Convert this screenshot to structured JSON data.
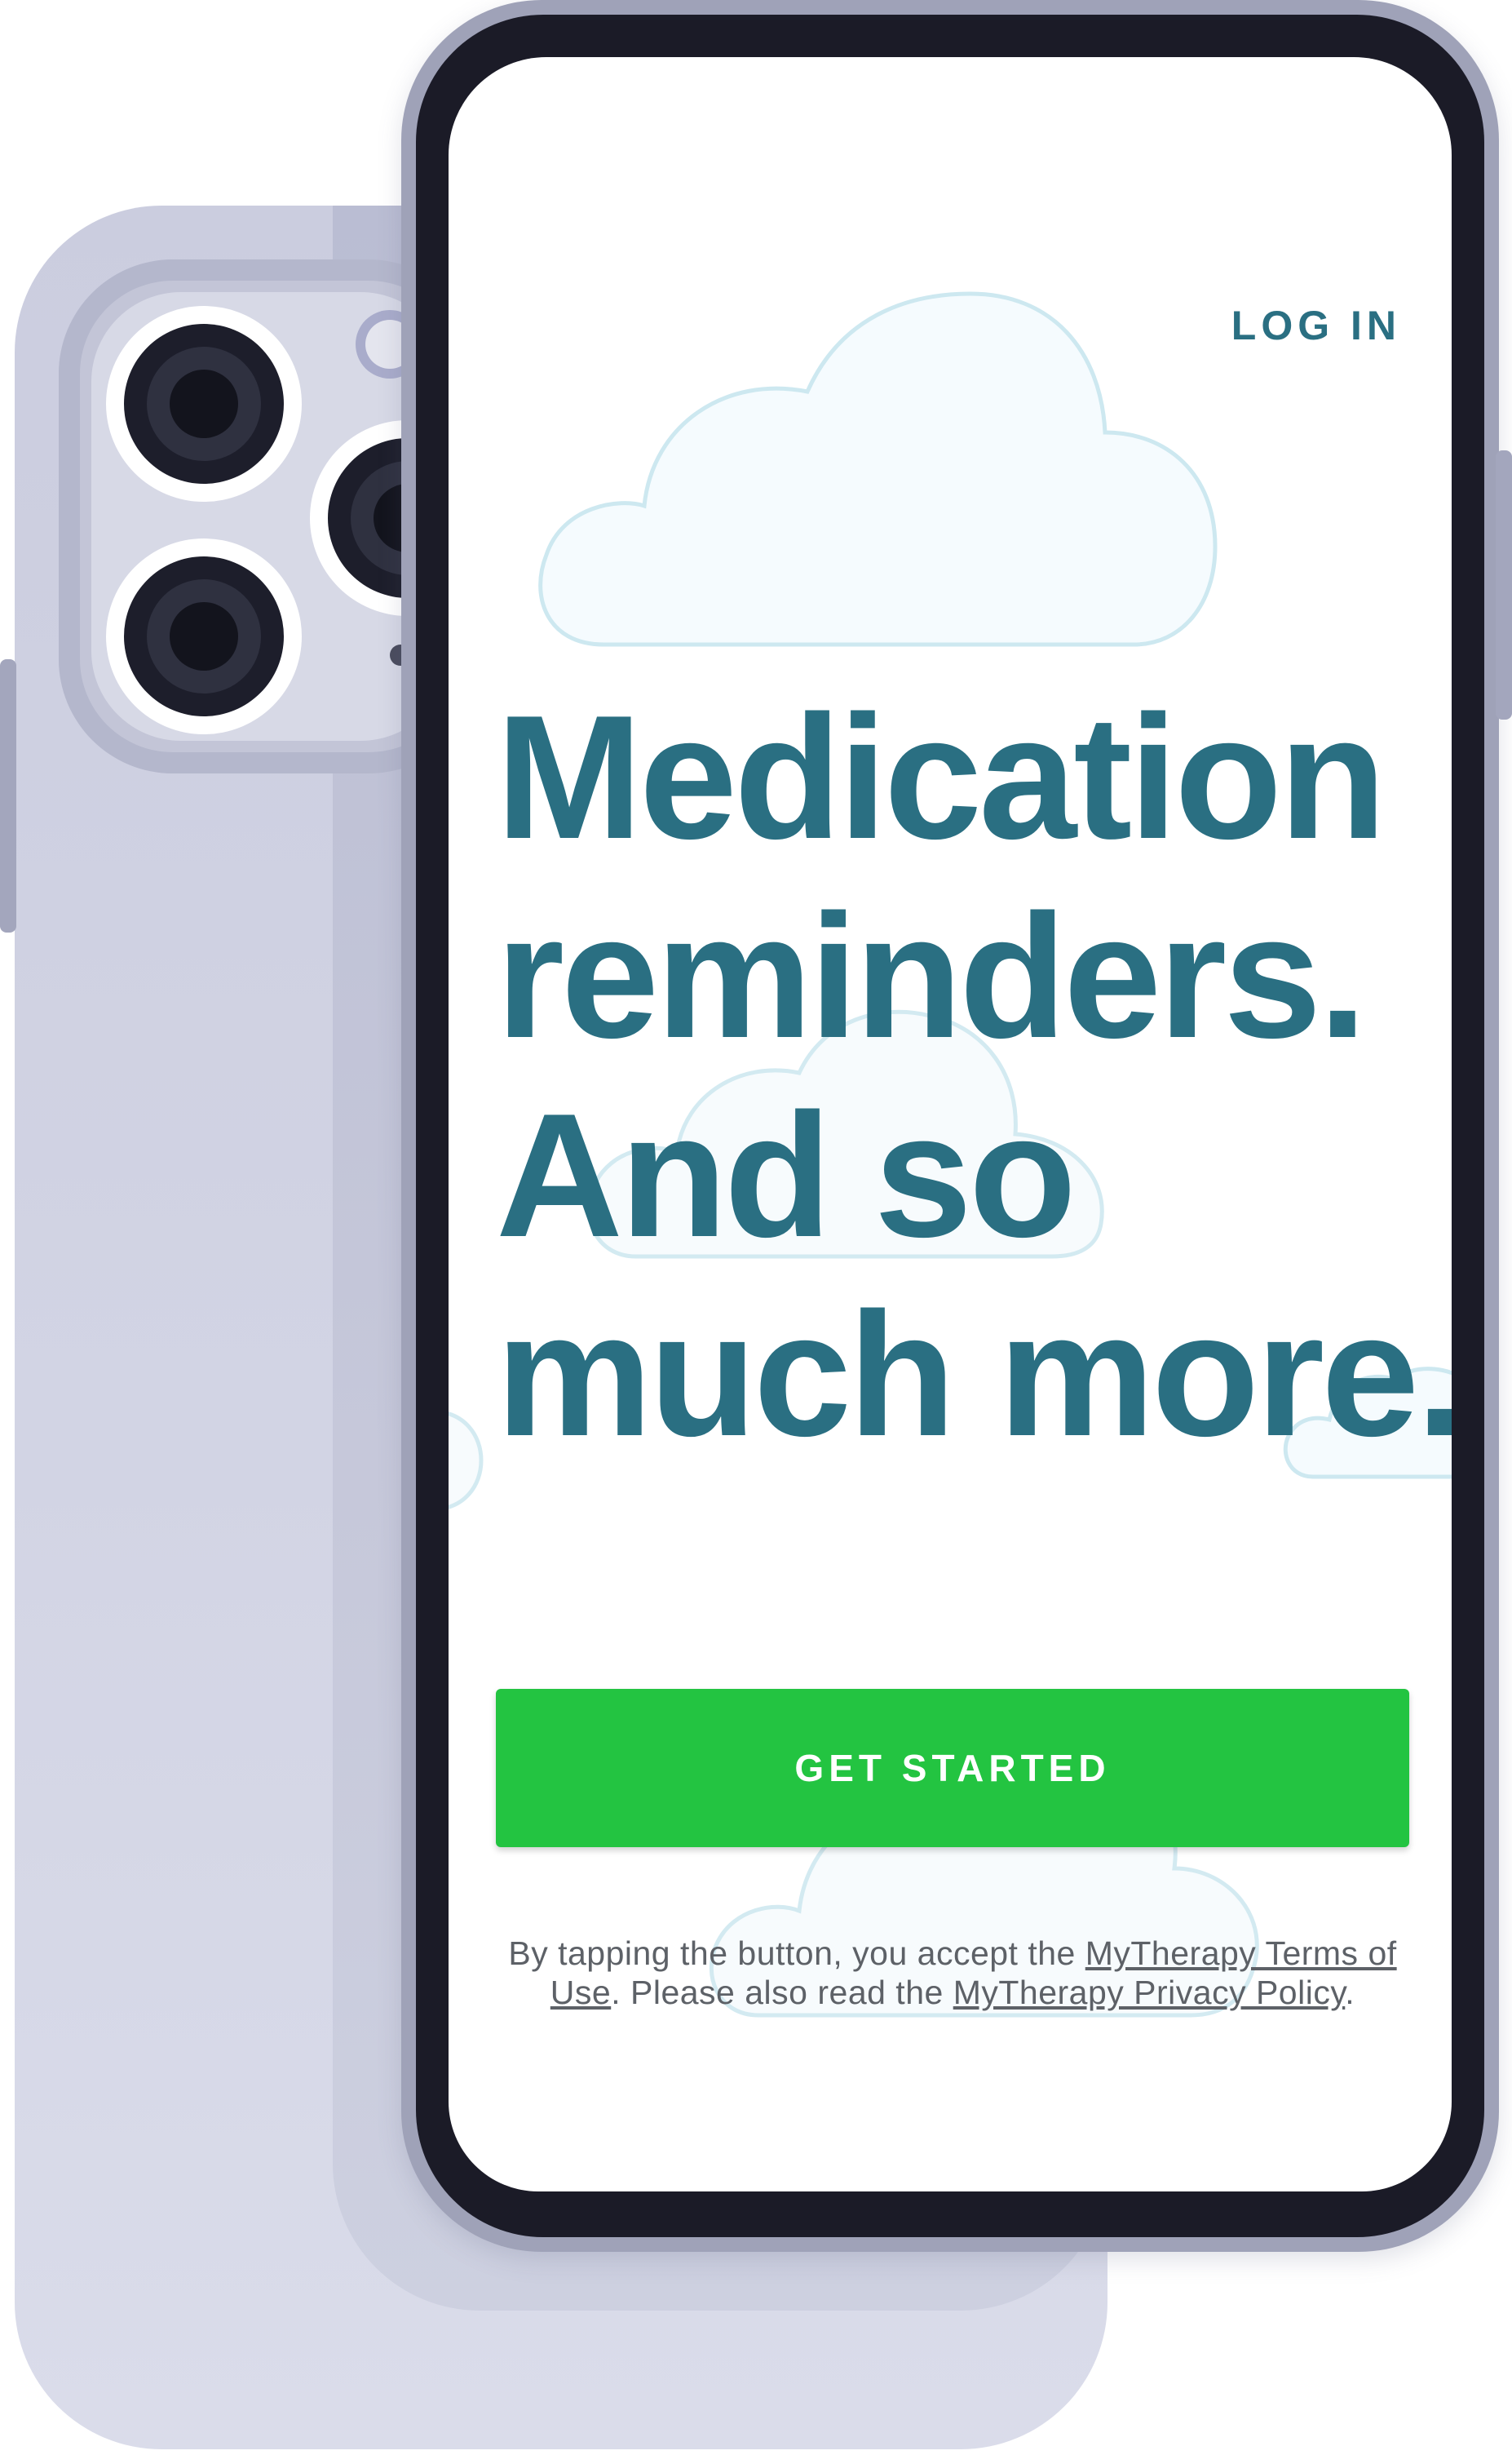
{
  "screen": {
    "login_label": "LOG IN",
    "headline": {
      "line1": "Medication",
      "line2": "reminders.",
      "line3": "And so",
      "line4": "much more."
    },
    "cta_label": "GET STARTED",
    "legal": {
      "prefix": "By tapping the button, you accept the ",
      "terms_link": "MyTherapy Terms of Use",
      "middle": ". Please also read the ",
      "privacy_link": "MyTherapy Privacy Policy",
      "suffix": "."
    }
  },
  "colors": {
    "brand_text": "#2a6f82",
    "cta_green": "#23c441",
    "legal_text": "#5d6167",
    "cloud_stroke": "#cde8f0",
    "phone_frame": "#9fa2b8",
    "bezel": "#1b1b27"
  },
  "icons": {
    "cloud": "cloud-icon",
    "camera": "camera-lens-icon"
  }
}
